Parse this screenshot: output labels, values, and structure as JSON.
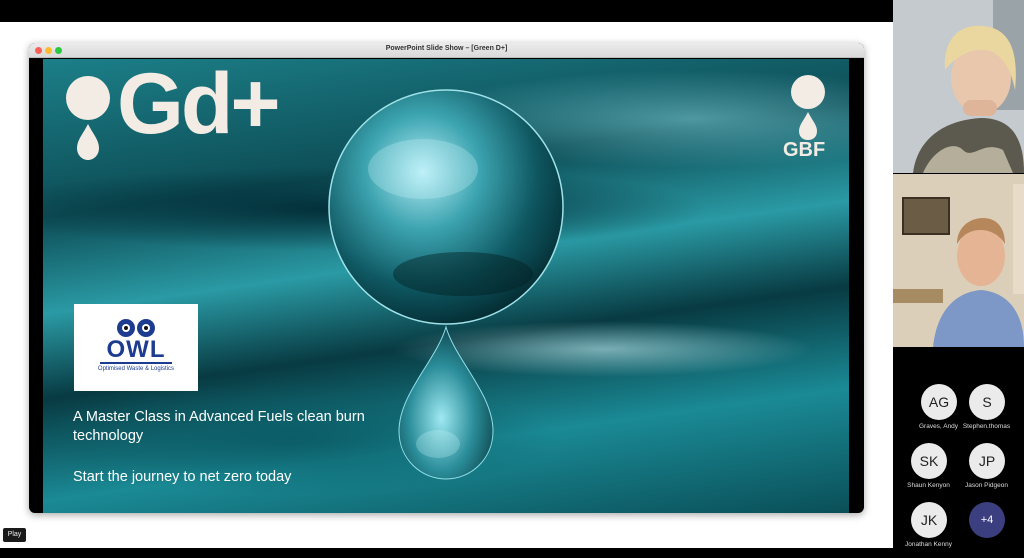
{
  "window": {
    "title": "PowerPoint Slide Show – [Green D+]"
  },
  "slide": {
    "brand_title": "Gd+",
    "corner_logo_text": "GBF",
    "partner_logo": {
      "name": "OWL",
      "tagline": "Optimised Waste & Logistics"
    },
    "headline": "A Master Class in Advanced Fuels clean burn technology",
    "subheadline": "Start the journey to net zero today"
  },
  "participants": [
    {
      "initials": "AG",
      "name": "Graves, Andy"
    },
    {
      "initials": "S",
      "name": "Stephen.thomas"
    },
    {
      "initials": "SK",
      "name": "Shaun Kenyon"
    },
    {
      "initials": "JP",
      "name": "Jason Pidgeon"
    },
    {
      "initials": "JK",
      "name": "Jonathan Kenny"
    },
    {
      "initials": "+4",
      "name": ""
    }
  ],
  "controls": {
    "play_label": "Play"
  },
  "colors": {
    "slide_accent": "#1c7f88",
    "logo_cream": "#f3ece4",
    "owl_blue": "#1d3c8f",
    "more_avatar": "#3b3f80"
  }
}
